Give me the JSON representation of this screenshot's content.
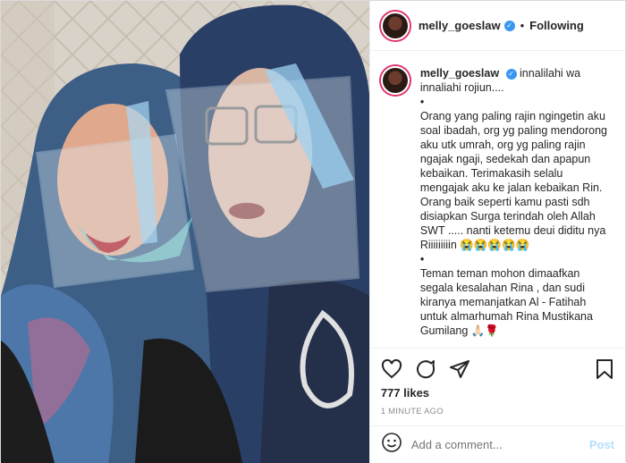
{
  "header": {
    "username": "melly_goeslaw",
    "separator": "•",
    "follow_label": "Following"
  },
  "caption": {
    "username": "melly_goeslaw",
    "line1": "innalilahi wa innaliahi rojiun....",
    "bullet1": "•",
    "para1": "Orang yang paling rajin ngingetin aku soal ibadah, org yg paling mendorong aku utk umrah, org yg paling rajin ngajak ngaji, sedekah dan apapun kebaikan. Terimakasih selalu mengajak aku ke jalan kebaikan Rin. Orang baik seperti kamu pasti sdh disiapkan Surga terindah oleh Allah SWT ..... nanti ketemu deui diditu nya Riiiiiiiiin 😭😭😭😭😭",
    "bullet2": "•",
    "para2": "Teman teman mohon dimaafkan segala kesalahan Rina , dan sudi kiranya memanjatkan Al - Fatihah untuk almarhumah Rina Mustikana Gumilang 🙏🏻🌹",
    "age": "1m"
  },
  "actions": {
    "like_icon": "heart-icon",
    "comment_icon": "comment-icon",
    "share_icon": "share-icon",
    "save_icon": "bookmark-icon",
    "likes": "777 likes",
    "time": "1 MINUTE AGO"
  },
  "comment_box": {
    "placeholder": "Add a comment...",
    "post_label": "Post",
    "emoji_icon": "smiley-icon"
  },
  "colors": {
    "verified": "#3897f0",
    "post_button": "#b2dffc",
    "meta_text": "#8e8e8e"
  }
}
